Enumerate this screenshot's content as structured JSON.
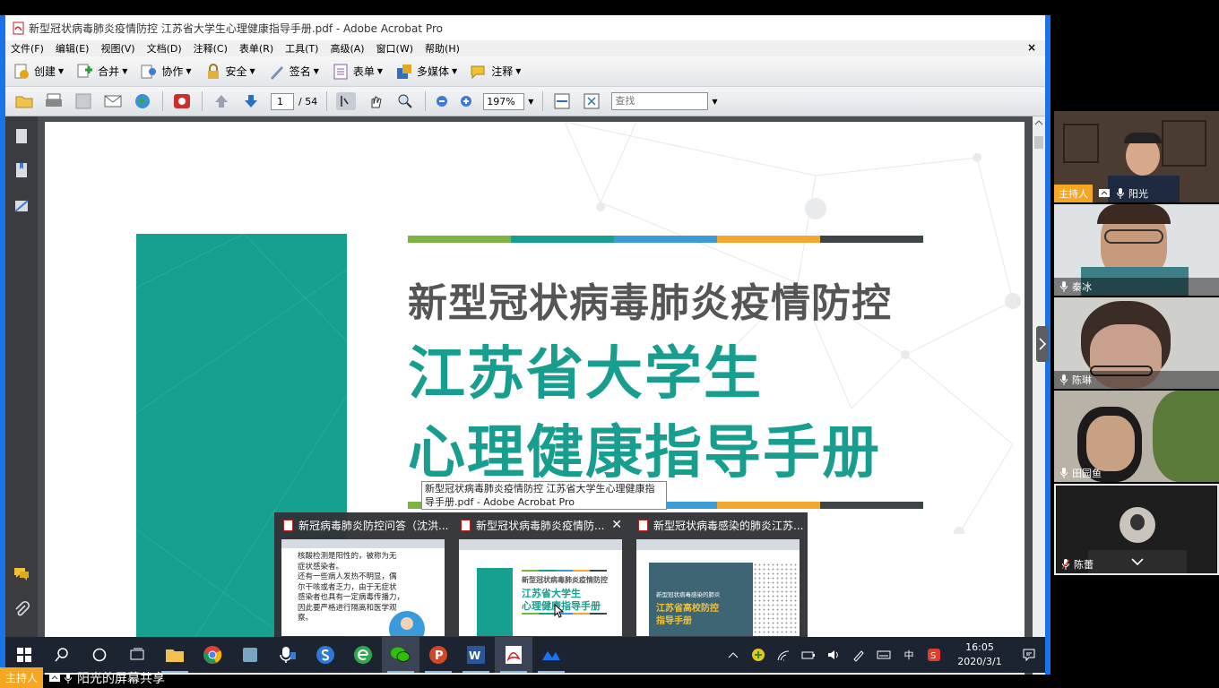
{
  "app": {
    "window_title": "新型冠状病毒肺炎疫情防控 江苏省大学生心理健康指导手册.pdf - Adobe Acrobat Pro"
  },
  "menu": {
    "items": [
      "文件(F)",
      "编辑(E)",
      "视图(V)",
      "文档(D)",
      "注释(C)",
      "表单(R)",
      "工具(T)",
      "高级(A)",
      "窗口(W)",
      "帮助(H)"
    ],
    "close_label": "×"
  },
  "toolbar1": {
    "create": "创建",
    "combine": "合并",
    "collaborate": "协作",
    "secure": "安全",
    "sign": "签名",
    "forms": "表单",
    "multimedia": "多媒体",
    "comment": "注释"
  },
  "toolbar2": {
    "page_current": "1",
    "page_total": "/ 54",
    "zoom": "197%",
    "find_placeholder": "查找"
  },
  "document": {
    "title_line1": "新型冠状病毒肺炎疫情防控",
    "title_line2": "江苏省大学生",
    "title_line3": "心理健康指导手册",
    "colors": [
      "#7cb342",
      "#189e8f",
      "#3a9bd5",
      "#f0a830",
      "#3d4548"
    ]
  },
  "tooltip": {
    "text": "新型冠状病毒肺炎疫情防控 江苏省大学生心理健康指导手册.pdf - Adobe Acrobat Pro"
  },
  "previews": [
    {
      "title": "新冠病毒肺炎防控问答（沈洪..."
    },
    {
      "title": "新型冠状病毒肺炎疫情防...",
      "close": "✕",
      "thumb_line1": "新型冠状病毒肺炎疫情防控",
      "thumb_line2": "江苏省大学生",
      "thumb_line3": "心理健康指导手册"
    },
    {
      "title": "新型冠状病毒感染的肺炎江苏...",
      "thumb_line1": "新型冠状病毒感染的肺炎",
      "thumb_line2": "江苏省高校防控",
      "thumb_line3": "指导手册"
    }
  ],
  "preview_text": {
    "line1": "核酸检测是阳性的，被称为无",
    "line2": "症状感染者。",
    "line3": "还有一些病人发热不明显，偶",
    "line4": "尔干咳或者乏力，由于无症状",
    "line5": "感染者也具有一定病毒传播力，",
    "line6": "因此要严格进行隔离和医学观",
    "line7": "察。"
  },
  "participants": [
    {
      "name": "阳光",
      "host_badge": "主持人"
    },
    {
      "name": "秦冰"
    },
    {
      "name": "陈琳"
    },
    {
      "name": "田园鱼"
    },
    {
      "name": "陈蕾"
    }
  ],
  "taskbar": {
    "time": "16:05",
    "date": "2020/3/1",
    "ime": "中"
  },
  "bottom": {
    "host_badge": "主持人",
    "share_label": "阳光的屏幕共享"
  }
}
